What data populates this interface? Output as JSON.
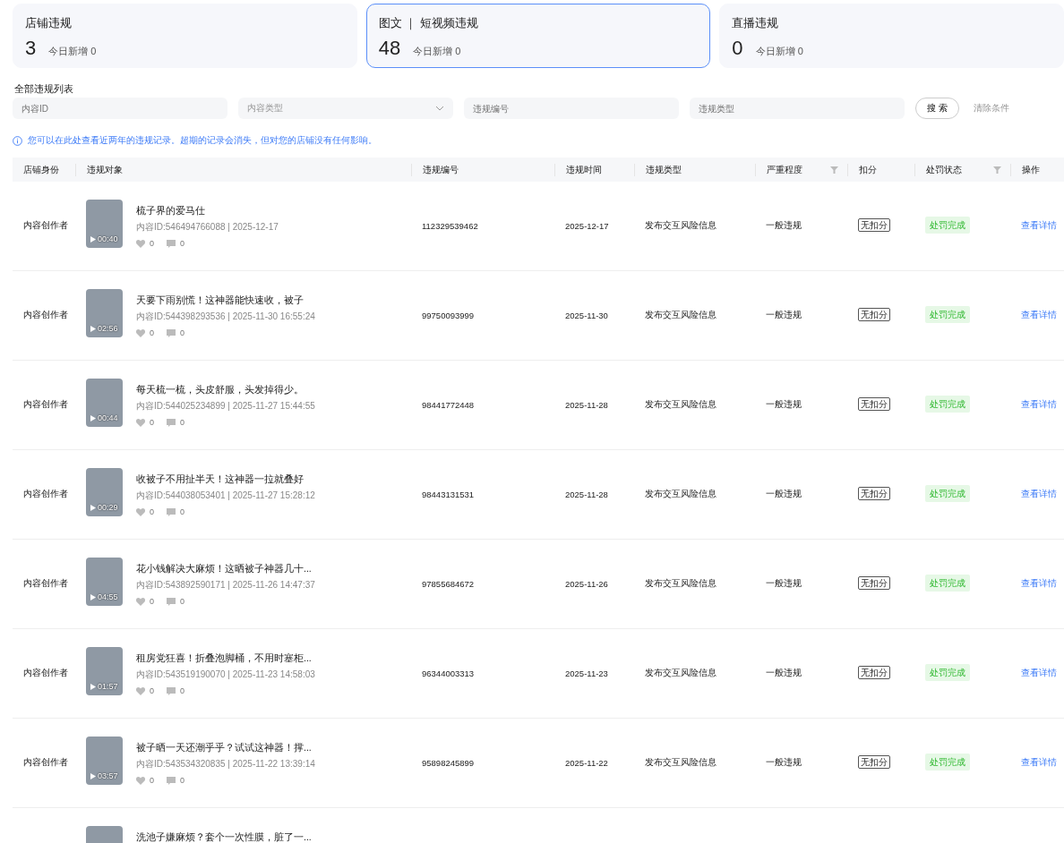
{
  "summary_cards": [
    {
      "title": "店铺违规",
      "count": "3",
      "today": "今日新增 0",
      "selected": false
    },
    {
      "title": "图文 ｜ 短视频违规",
      "count": "48",
      "today": "今日新增 0",
      "selected": true
    },
    {
      "title": "直播违规",
      "count": "0",
      "today": "今日新增 0",
      "selected": false
    }
  ],
  "list_title": "全部违规列表",
  "filters": [
    {
      "kind": "input",
      "placeholder": "内容ID"
    },
    {
      "kind": "select",
      "placeholder": "内容类型"
    },
    {
      "kind": "input",
      "placeholder": "违规编号"
    },
    {
      "kind": "input",
      "placeholder": "违规类型"
    }
  ],
  "search_button": "搜 索",
  "clear_link": "清除条件",
  "notice": "您可以在此处查看近两年的违规记录。超期的记录会消失，但对您的店铺没有任何影响。",
  "table": {
    "columns": [
      {
        "label": "店铺身份",
        "kind": "plain"
      },
      {
        "label": "违规对象",
        "kind": "plain"
      },
      {
        "label": "违规编号",
        "kind": "plain"
      },
      {
        "label": "违规时间",
        "kind": "plain"
      },
      {
        "label": "违规类型",
        "kind": "plain"
      },
      {
        "label": "严重程度",
        "kind": "filterable"
      },
      {
        "label": "扣分",
        "kind": "plain"
      },
      {
        "label": "处罚状态",
        "kind": "filterable"
      },
      {
        "label": "操作",
        "kind": "plain"
      }
    ],
    "rows": [
      {
        "identity": "内容创作者",
        "duration": "00:40",
        "title": "梳子界的爱马仕",
        "meta": "内容ID:546494766088 | 2025-12-17",
        "likes": "0",
        "comments": "0",
        "number": "112329539462",
        "date": "2025-12-17",
        "type": "发布交互风险信息",
        "severity": "一般违规",
        "points": "无扣分",
        "status": "处罚完成",
        "action": "查看详情"
      },
      {
        "identity": "内容创作者",
        "duration": "02:56",
        "title": "天要下雨别慌！这神器能快速收，被子",
        "meta": "内容ID:544398293536 | 2025-11-30 16:55:24",
        "likes": "0",
        "comments": "0",
        "number": "99750093999",
        "date": "2025-11-30",
        "type": "发布交互风险信息",
        "severity": "一般违规",
        "points": "无扣分",
        "status": "处罚完成",
        "action": "查看详情"
      },
      {
        "identity": "内容创作者",
        "duration": "00:44",
        "title": "每天梳一梳，头皮舒服，头发掉得少。",
        "meta": "内容ID:544025234899 | 2025-11-27 15:44:55",
        "likes": "0",
        "comments": "0",
        "number": "98441772448",
        "date": "2025-11-28",
        "type": "发布交互风险信息",
        "severity": "一般违规",
        "points": "无扣分",
        "status": "处罚完成",
        "action": "查看详情"
      },
      {
        "identity": "内容创作者",
        "duration": "00:29",
        "title": "收被子不用扯半天！这神器一拉就叠好",
        "meta": "内容ID:544038053401 | 2025-11-27 15:28:12",
        "likes": "0",
        "comments": "0",
        "number": "98443131531",
        "date": "2025-11-28",
        "type": "发布交互风险信息",
        "severity": "一般违规",
        "points": "无扣分",
        "status": "处罚完成",
        "action": "查看详情"
      },
      {
        "identity": "内容创作者",
        "duration": "04:55",
        "title": "花小钱解决大麻烦！这晒被子神器几十...",
        "meta": "内容ID:543892590171 | 2025-11-26 14:47:37",
        "likes": "0",
        "comments": "0",
        "number": "97855684672",
        "date": "2025-11-26",
        "type": "发布交互风险信息",
        "severity": "一般违规",
        "points": "无扣分",
        "status": "处罚完成",
        "action": "查看详情"
      },
      {
        "identity": "内容创作者",
        "duration": "01:57",
        "title": "租房党狂喜！折叠泡脚桶，不用时塞柜...",
        "meta": "内容ID:543519190070 | 2025-11-23 14:58:03",
        "likes": "0",
        "comments": "0",
        "number": "96344003313",
        "date": "2025-11-23",
        "type": "发布交互风险信息",
        "severity": "一般违规",
        "points": "无扣分",
        "status": "处罚完成",
        "action": "查看详情"
      },
      {
        "identity": "内容创作者",
        "duration": "03:57",
        "title": "被子晒一天还潮乎乎？试试这神器！撑...",
        "meta": "内容ID:543534320835 | 2025-11-22 13:39:14",
        "likes": "0",
        "comments": "0",
        "number": "95898245899",
        "date": "2025-11-22",
        "type": "发布交互风险信息",
        "severity": "一般违规",
        "points": "无扣分",
        "status": "处罚完成",
        "action": "查看详情"
      },
      {
        "title": "洗池子嫌麻烦？套个一次性膜，脏了一..."
      }
    ]
  }
}
